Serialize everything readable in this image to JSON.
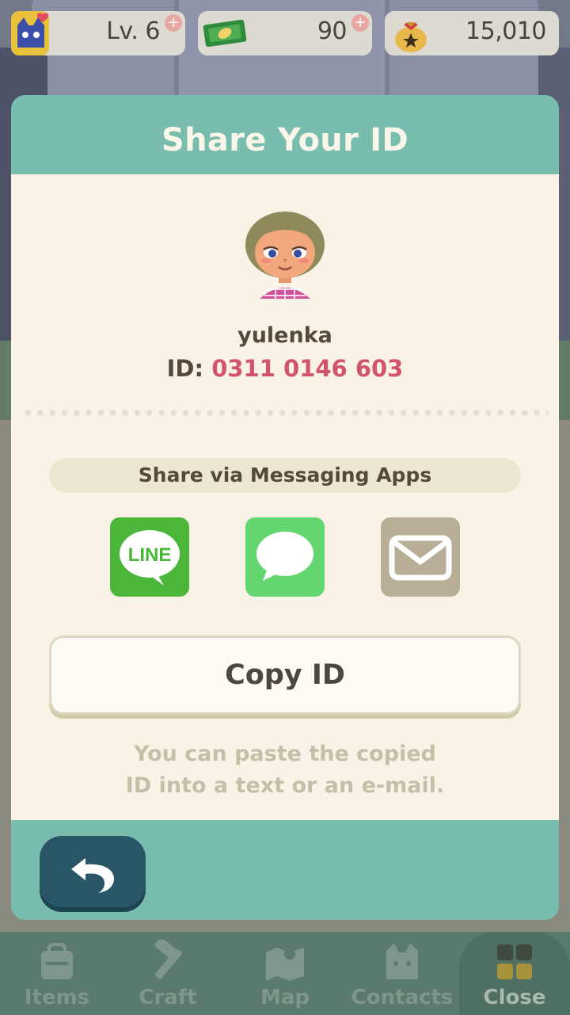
{
  "status": {
    "level": "Lv. 6",
    "tickets": "90",
    "bells": "15,010"
  },
  "modal": {
    "title": "Share Your ID",
    "username": "yulenka",
    "id_label": "ID:",
    "id_value": "0311 0146 603",
    "share_label": "Share via Messaging Apps",
    "apps": {
      "line_label": "LINE",
      "message_icon": "speech-bubble-icon",
      "mail_icon": "envelope-icon"
    },
    "copy_label": "Copy ID",
    "hint_line1": "You can paste the copied",
    "hint_line2": "ID into a text or an e-mail."
  },
  "tabs": [
    {
      "label": "Items"
    },
    {
      "label": "Craft"
    },
    {
      "label": "Map"
    },
    {
      "label": "Contacts"
    },
    {
      "label": "Close"
    }
  ],
  "colors": {
    "header_teal": "#78bdad",
    "body_cream": "#f8f3e6",
    "id_pink": "#d3546a",
    "line_green": "#4cb63b",
    "message_green": "#63d66f",
    "mail_tan": "#b7ae95",
    "back_button": "#285666"
  }
}
